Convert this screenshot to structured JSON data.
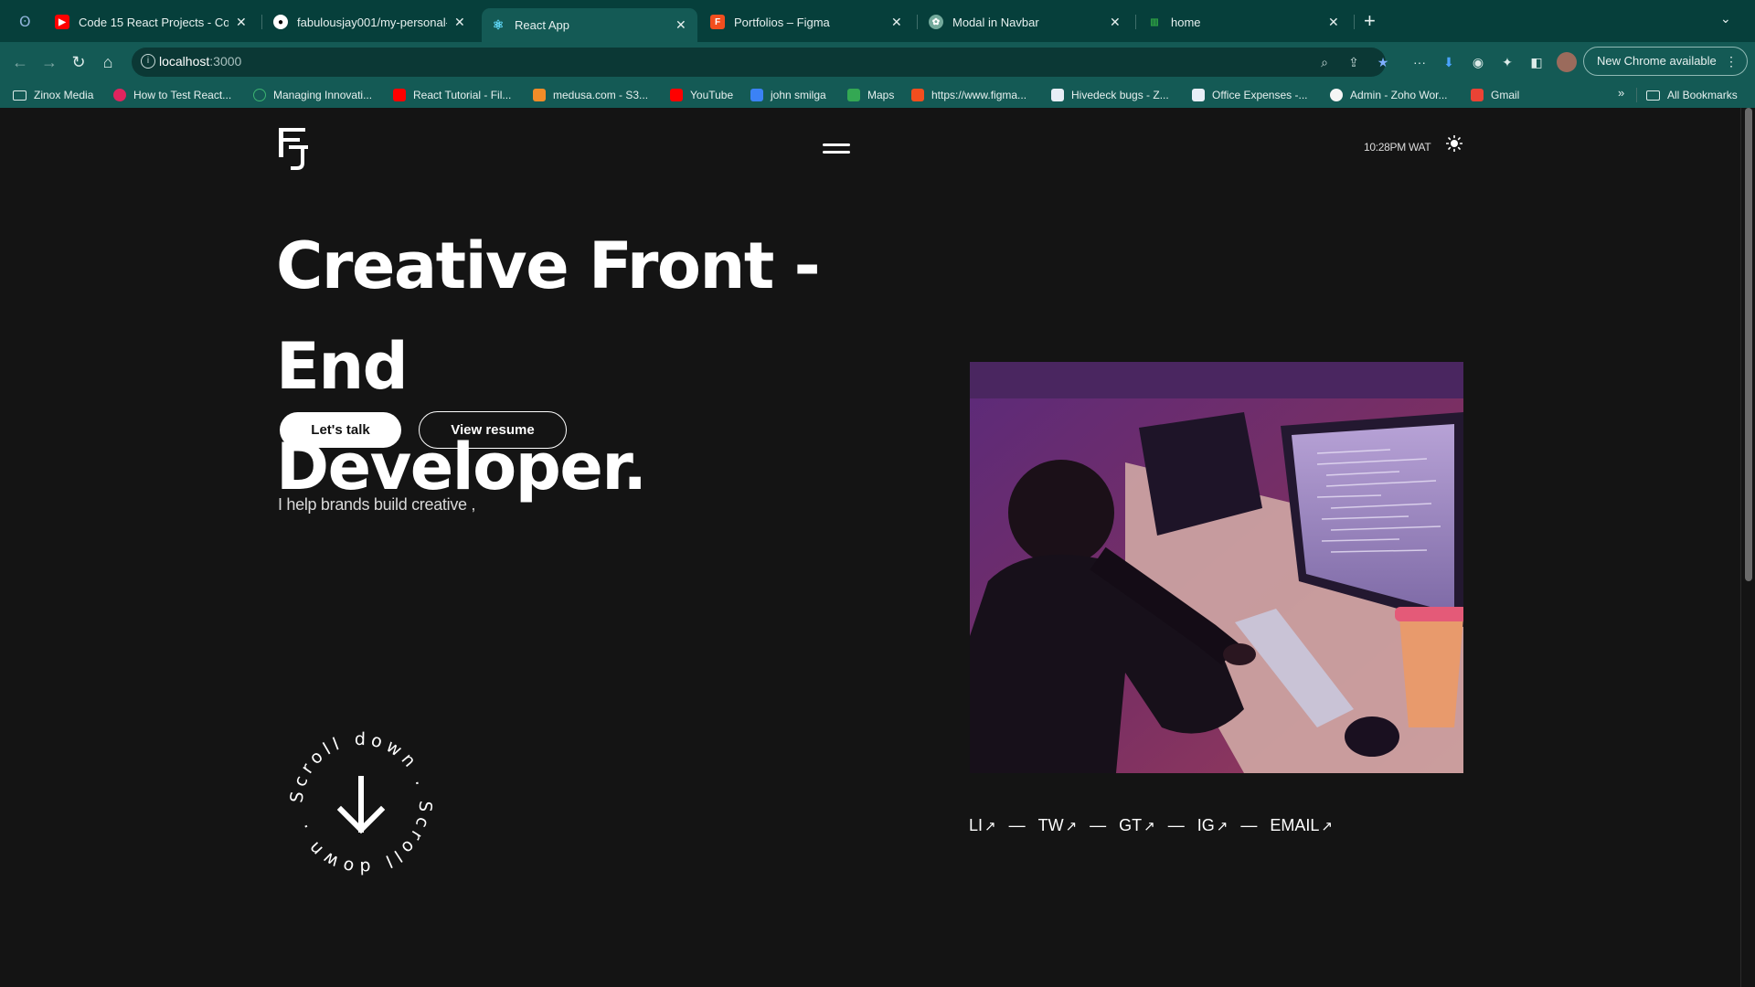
{
  "browser": {
    "tabs": [
      {
        "title": "Code 15 React Projects - Com",
        "favicon": "youtube-icon",
        "color": "#ff0000"
      },
      {
        "title": "fabulousjay001/my-personal-w",
        "favicon": "github-icon",
        "color": "#ffffff"
      },
      {
        "title": "React App",
        "favicon": "react-icon",
        "color": "#61dafb",
        "active": true
      },
      {
        "title": "Portfolios – Figma",
        "favicon": "figma-icon",
        "color": "#f24e1e"
      },
      {
        "title": "Modal in Navbar",
        "favicon": "chatgpt-icon",
        "color": "#74aa9c"
      },
      {
        "title": "home",
        "favicon": "bars-icon",
        "color": "#2ea043"
      }
    ],
    "url": "localhost",
    "url_port": ":3000",
    "update_label": "New Chrome available",
    "bookmarks": [
      "Zinox Media",
      "How to Test React...",
      "Managing Innovati...",
      "React Tutorial - Fil...",
      "medusa.com - S3...",
      "YouTube",
      "john smilga",
      "Maps",
      "https://www.figma...",
      "Hivedeck bugs - Z...",
      "Office Expenses -...",
      "Admin - Zoho Wor...",
      "Gmail"
    ],
    "all_bookmarks": "All Bookmarks"
  },
  "site": {
    "logo_text": "FJ",
    "clock": "10:28PM WAT",
    "hero_line1": "Creative Front - End",
    "hero_line2": "Developer.",
    "cta_primary": "Let's talk",
    "cta_secondary": "View resume",
    "tagline": "I help brands build creative ,",
    "scroll_badge_text": "Scroll down . Scroll down .",
    "socials": [
      {
        "label": "LI"
      },
      {
        "label": "TW"
      },
      {
        "label": "GT"
      },
      {
        "label": "IG"
      },
      {
        "label": "EMAIL"
      }
    ],
    "social_arrow": "↗",
    "social_separator": "—"
  },
  "colors": {
    "page_bg": "#141414",
    "chrome_dark": "#063f3b",
    "chrome_toolbar": "#145a55",
    "text": "#ffffff"
  }
}
